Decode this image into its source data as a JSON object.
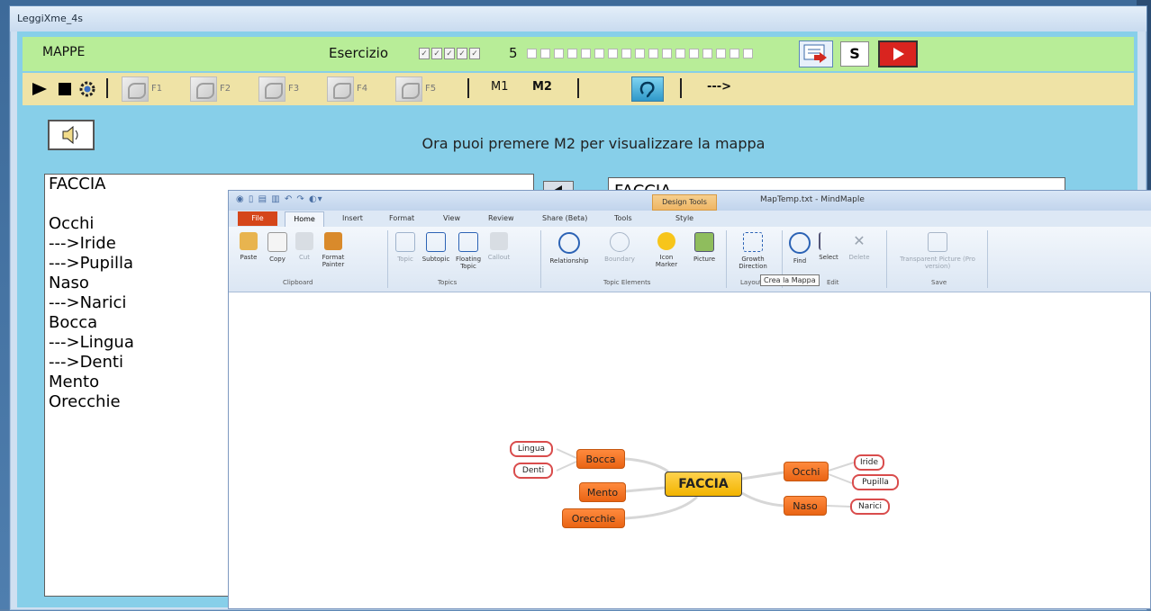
{
  "window": {
    "title": "LeggiXme_4s"
  },
  "header": {
    "section": "MAPPE",
    "exercise_label": "Esercizio",
    "exercise_ticks": [
      "✓",
      "✓",
      "✓",
      "✓",
      "✓"
    ],
    "exercise_count": "5",
    "progress_cells": 17,
    "s_label": "S"
  },
  "toolbar": {
    "f_keys": [
      "F1",
      "F2",
      "F3",
      "F4",
      "F5"
    ],
    "m1": "M1",
    "m2": "M2",
    "arrow": "--->"
  },
  "instruction": "Ora puoi premere M2 per visualizzare la mappa",
  "left_text": [
    "FACCIA",
    "",
    "Occhi",
    "--->Iride",
    "--->Pupilla",
    "Naso",
    "--->Narici",
    "Bocca",
    "--->Lingua",
    "--->Denti",
    "Mento",
    "Orecchie"
  ],
  "right_text": "FACCIA",
  "mindmaple": {
    "title": "MapTemp.txt - MindMaple",
    "design_tools": "Design Tools",
    "tabs": [
      "File",
      "Home",
      "Insert",
      "Format",
      "View",
      "Review",
      "Share (Beta)",
      "Tools",
      "Style"
    ],
    "ribbon_buttons": [
      "Paste",
      "Copy",
      "Cut",
      "Format Painter",
      "Topic",
      "Subtopic",
      "Floating Topic",
      "Callout",
      "Relationship",
      "Boundary",
      "Icon Marker",
      "Picture",
      "Growth Direction",
      "Find",
      "Select",
      "Delete",
      "Transparent Picture (Pro version)"
    ],
    "groups": [
      "Clipboard",
      "Topics",
      "Topic Elements",
      "Layout",
      "Edit",
      "Save"
    ],
    "tooltip": "Crea la Mappa"
  },
  "map": {
    "root": "FACCIA",
    "topics": [
      "Bocca",
      "Mento",
      "Orecchie",
      "Occhi",
      "Naso"
    ],
    "subtopics": [
      "Lingua",
      "Denti",
      "Iride",
      "Pupilla",
      "Narici"
    ]
  }
}
